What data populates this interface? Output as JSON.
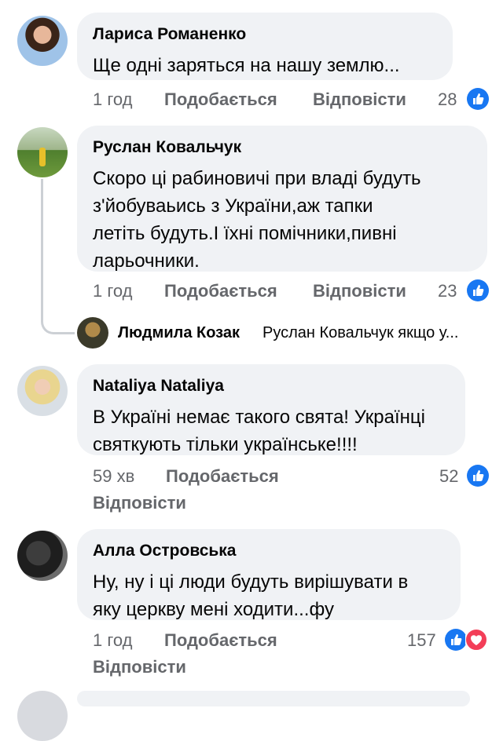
{
  "colors": {
    "like_blue": "#1877f2",
    "love_red": "#f33e58",
    "meta_gray": "#65676b",
    "bubble_bg": "#f0f2f5"
  },
  "actions": {
    "like": "Подобається",
    "reply": "Відповісти"
  },
  "comments": [
    {
      "author": "Лариса Романенко",
      "text": "Ще одні заряться на нашу землю...",
      "time": "1 год",
      "reactions": "28",
      "reaction_icons": [
        "like-icon"
      ]
    },
    {
      "author": "Руслан Ковальчук",
      "text": "Скоро ці рабиновичі при владі будуть\nз'йобуваьись з України,аж тапки\nлетіть будуть.І їхні помічники,пивні\nларьочники.",
      "time": "1 год",
      "reactions": "23",
      "reaction_icons": [
        "like-icon"
      ]
    },
    {
      "author": "Nataliya Nataliya",
      "text": "В Україні немає такого свята! Українці\nсвяткують тільки українське!!!!",
      "time": "59 хв",
      "reactions": "52",
      "reaction_icons": [
        "like-icon"
      ]
    },
    {
      "author": "Алла Островська",
      "text": "Ну, ну і ці люди будуть вирішувати в\nяку церкву мені ходити...фу",
      "time": "1 год",
      "reactions": "157",
      "reaction_icons": [
        "like-icon",
        "love-icon"
      ]
    }
  ],
  "reply": {
    "author": "Людмила Козак",
    "preview": "Руслан Ковальчук якщо у..."
  }
}
